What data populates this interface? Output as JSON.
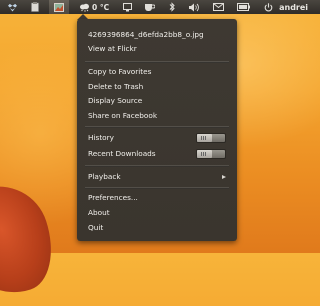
{
  "panel": {
    "weather_temp": "0 °C",
    "user_name": "andrei",
    "icons": [
      "dropbox-icon",
      "clipboard-icon",
      "shotwell-indicator-icon",
      "weather-cloud-icon",
      "display-icon",
      "coffee-cup-icon",
      "bluetooth-icon",
      "volume-icon",
      "mail-icon",
      "battery-icon",
      "power-icon"
    ]
  },
  "menu": {
    "filename": "4269396864_d6efda2bb8_o.jpg",
    "view_at_flickr": "View at Flickr",
    "copy_to_favorites": "Copy to Favorites",
    "delete_to_trash": "Delete to Trash",
    "display_source": "Display Source",
    "share_on_facebook": "Share on Facebook",
    "history": "History",
    "recent_downloads": "Recent Downloads",
    "playback": "Playback",
    "preferences": "Preferences...",
    "about": "About",
    "quit": "Quit",
    "history_toggle_on": false,
    "recent_downloads_toggle_on": false
  },
  "colors": {
    "menu_bg": "#3c372f",
    "panel_bg": "#3a3631",
    "desktop": "#f4a52f"
  }
}
